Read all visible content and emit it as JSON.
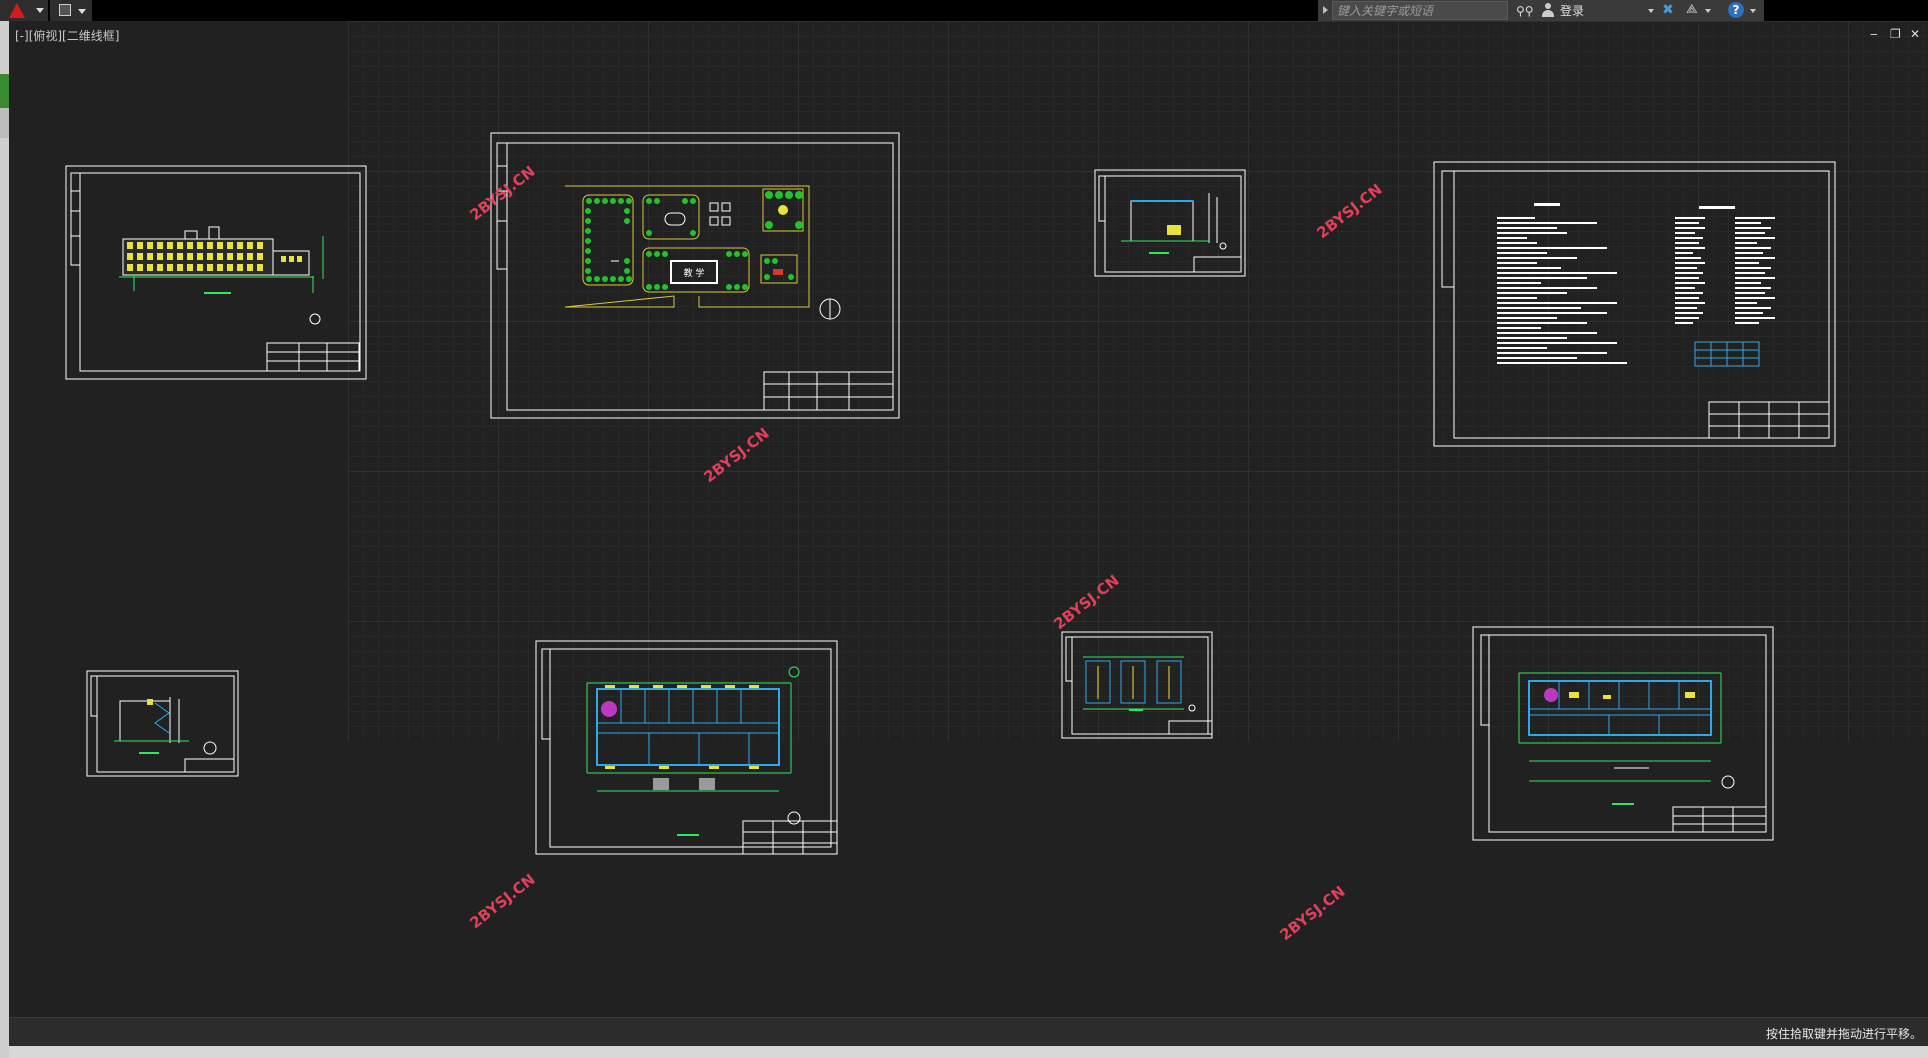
{
  "topbar": {
    "search_placeholder": "键入关键字或短语",
    "login_label": "登录"
  },
  "canvas": {
    "viewport_label": "[-][俯视][二维线框]",
    "controls": {
      "minimize": "‒",
      "restore": "❐",
      "close": "✕"
    },
    "watermarks": [
      "2BYSJ.CN",
      "2BYSJ.CN",
      "2BYSJ.CN",
      "2BYSJ.CN",
      "2BYSJ.CN",
      "2BYSJ.CN"
    ],
    "site_plan": {
      "building_label": "教 学"
    }
  },
  "statusbar": {
    "message": "按住拾取键并拖动进行平移。"
  },
  "colors": {
    "canvas_bg": "#212121",
    "watermark": "#e0405a",
    "drawing_frame": "#ffffff",
    "window_fill": "#e8e23c",
    "tree_green": "#22c22c",
    "dimension_green": "#2ee85a",
    "wall_cyan": "#2fa8e8"
  }
}
